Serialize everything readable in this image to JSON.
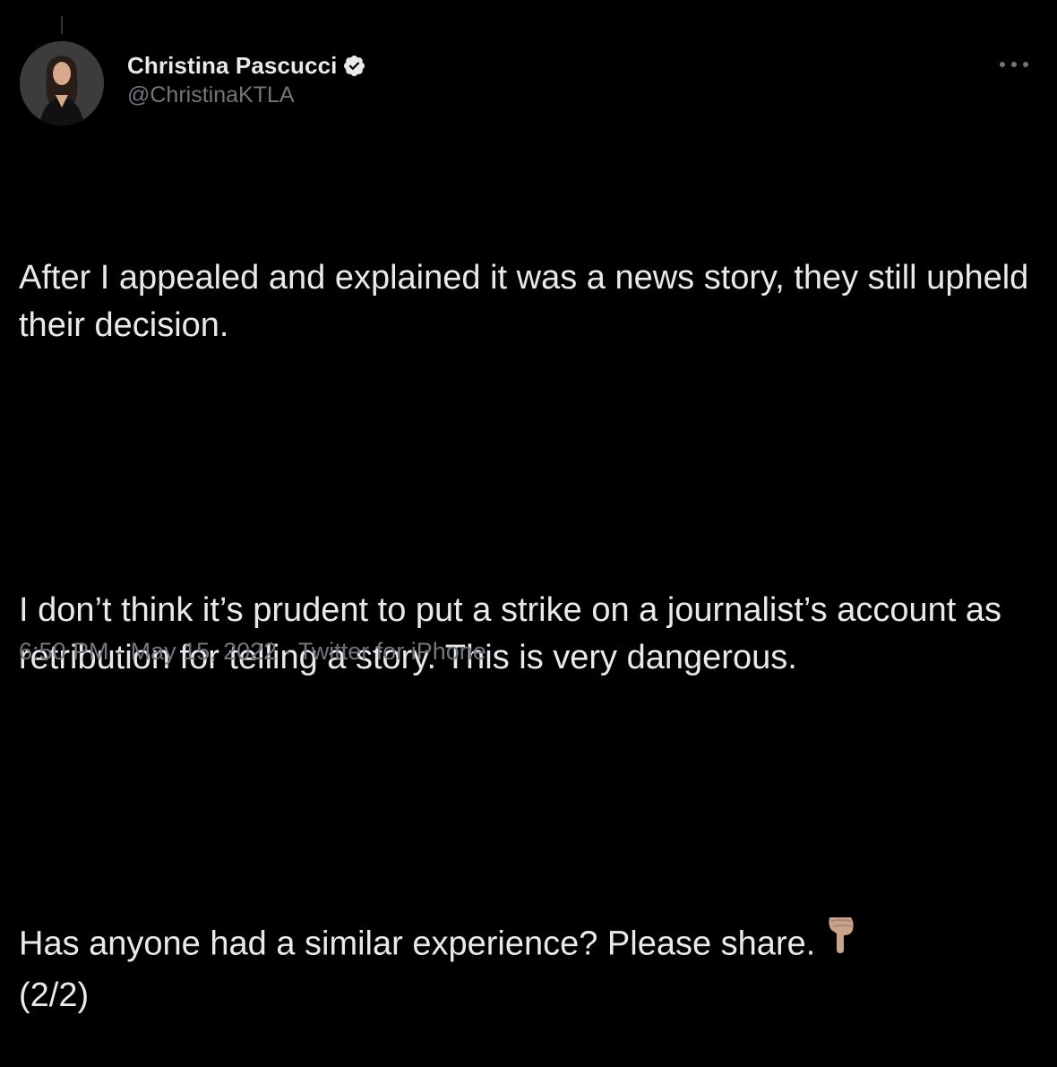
{
  "tweet": {
    "display_name": "Christina Pascucci",
    "handle": "@ChristinaKTLA",
    "verified": true,
    "paragraphs": [
      "After I appealed and explained it was a news story, they still upheld their decision.",
      "I don’t think it’s prudent to put a strike on a journalist’s account as retribution for telling a story. This is very dangerous.",
      "Has anyone had a similar experience? Please share."
    ],
    "paragraph3_suffix": "(2/2)",
    "emoji": "backhand-index-pointing-down",
    "time": "6:50 PM",
    "date": "May 15, 2022",
    "source": "Twitter for iPhone",
    "separator": "·"
  },
  "colors": {
    "background": "#000000",
    "text_primary": "#e7e9ea",
    "text_secondary": "#71767b",
    "verified_badge": "#e7e9ea",
    "emoji_skin": "#c8a48a"
  },
  "icons": {
    "more": "more-horizontal-icon",
    "verified": "verified-badge-icon"
  }
}
